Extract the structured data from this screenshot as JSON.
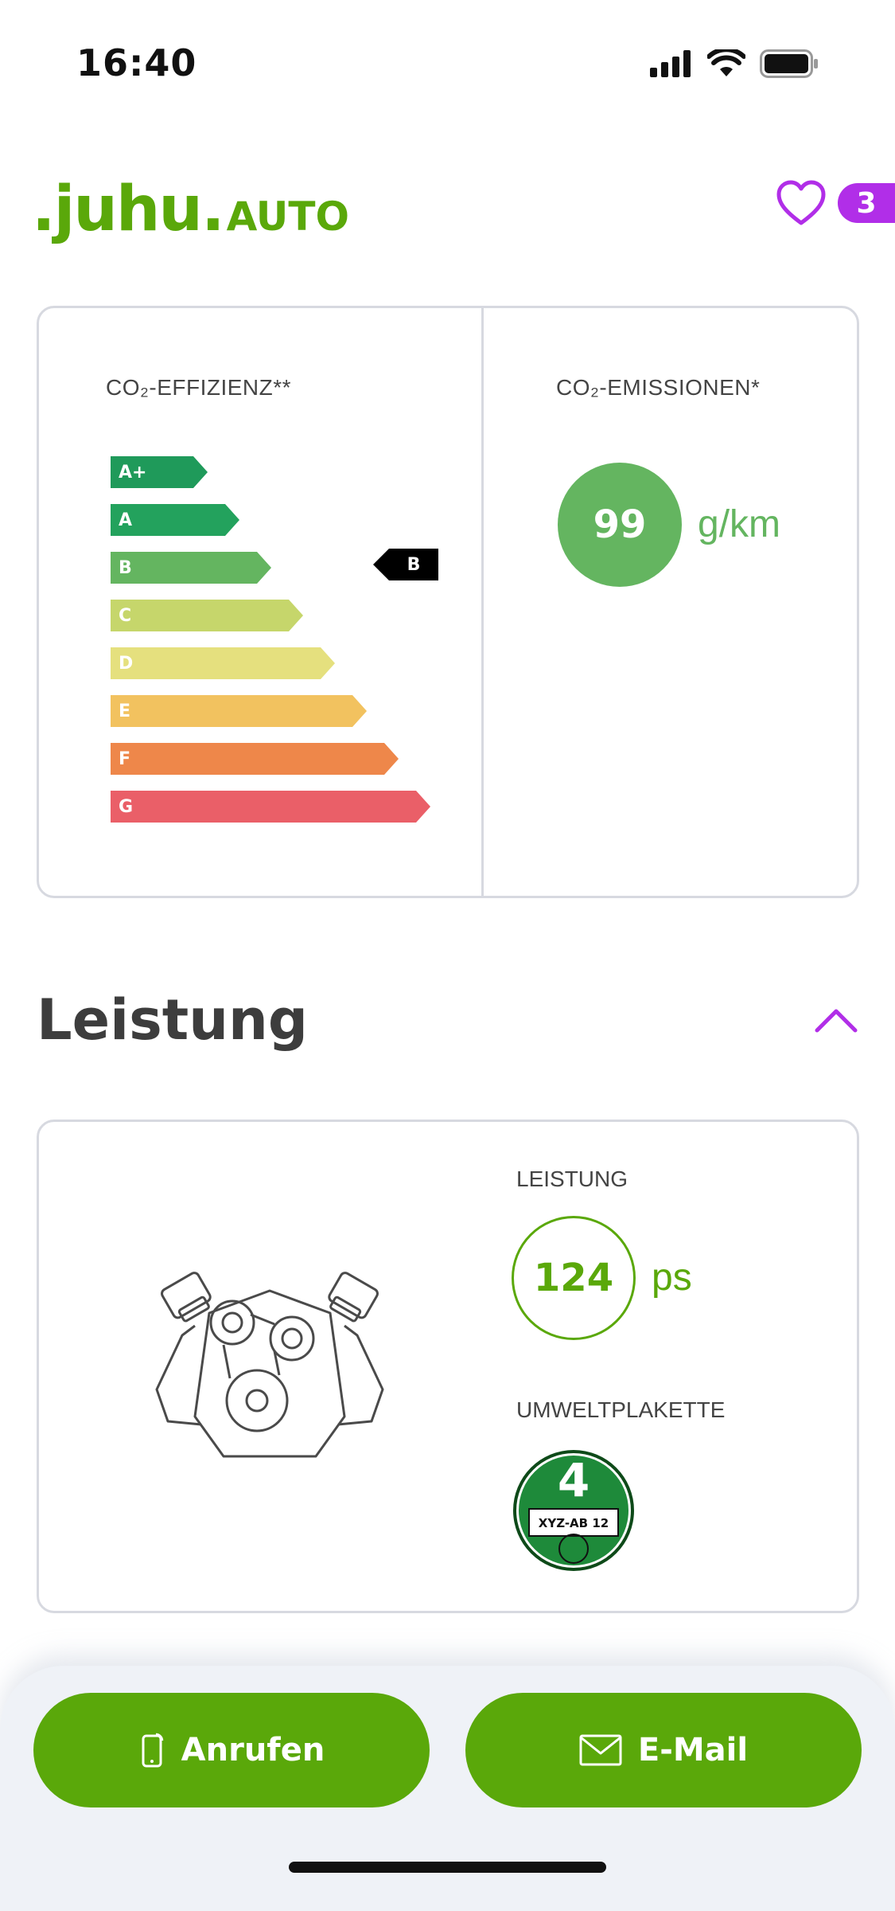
{
  "status": {
    "time": "16:40",
    "icons": [
      "signal-icon",
      "wifi-icon",
      "battery-icon"
    ]
  },
  "header": {
    "logo_main": ".juhu.",
    "logo_sub": "AUTO",
    "favorites_count": "3",
    "icons": [
      "heart-icon"
    ]
  },
  "co2": {
    "efficiency_label": "CO₂-EFFIZIENZ**",
    "emissions_label": "CO₂-EMISSIONEN*",
    "classes": [
      {
        "label": "A+",
        "color": "#1f9a5a"
      },
      {
        "label": "A",
        "color": "#23a25d"
      },
      {
        "label": "B",
        "color": "#64b560"
      },
      {
        "label": "C",
        "color": "#c6d66b"
      },
      {
        "label": "D",
        "color": "#e5e07e"
      },
      {
        "label": "E",
        "color": "#f2c25f"
      },
      {
        "label": "F",
        "color": "#ee874a"
      },
      {
        "label": "G",
        "color": "#ea5f68"
      }
    ],
    "current_class": "B",
    "emission_value": "99",
    "emission_unit": "g/km"
  },
  "leistung": {
    "section_title": "Leistung",
    "power_label": "LEISTUNG",
    "power_value": "124",
    "power_unit": "ps",
    "sticker_label": "UMWELTPLAKETTE",
    "sticker_number": "4",
    "sticker_plate": "XYZ-AB 12",
    "icons": [
      "engine-icon",
      "chevron-up-icon"
    ]
  },
  "actions": {
    "call_label": "Anrufen",
    "mail_label": "E-Mail",
    "icons": [
      "phone-icon",
      "mail-icon"
    ]
  },
  "colors": {
    "brand_green": "#5aa80a",
    "accent_purple": "#b12ee8",
    "border": "#d7d9e0"
  }
}
